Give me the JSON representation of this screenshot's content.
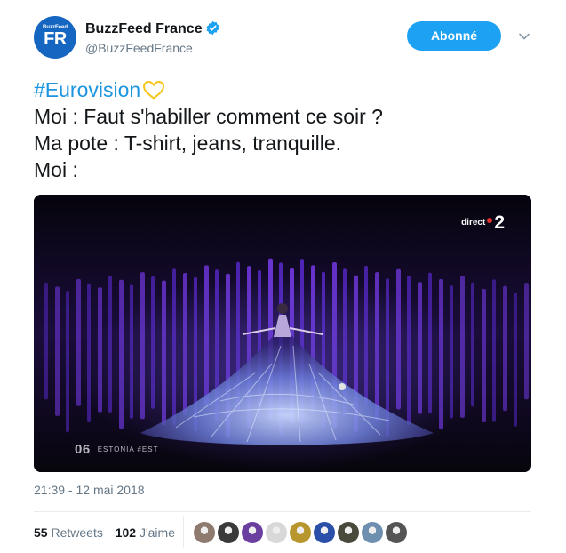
{
  "account": {
    "avatar_small": "BuzzFeed",
    "avatar_big": "FR",
    "name": "BuzzFeed France",
    "handle": "@BuzzFeedFrance",
    "verified_icon": "verified-badge-icon",
    "follow_label": "Abonné",
    "menu_icon": "chevron-down-icon"
  },
  "tweet": {
    "hashtag": "#Eurovision",
    "hashtag_emoji": "yellow-heart-icon",
    "line1": "Moi : Faut s'habiller comment ce soir ?",
    "line2": "Ma pote : T-shirt, jeans, tranquille.",
    "line3": "Moi :"
  },
  "media": {
    "channel_label": "direct",
    "channel_number": "2",
    "performer_number": "06",
    "performer_country": "ESTONIA #EST"
  },
  "meta": {
    "timestamp": "21:39 - 12 mai 2018",
    "retweets_count": "55",
    "retweets_label": "Retweets",
    "likes_count": "102",
    "likes_label": "J'aime"
  },
  "colors": {
    "accent": "#1da1f2",
    "hashtag": "#1b95e0",
    "avatar_bg": "#1566c0",
    "secondary_text": "#657786"
  },
  "likers": [
    {
      "name": "liker-avatar-1",
      "color": "#8f7a6e"
    },
    {
      "name": "liker-avatar-2",
      "color": "#3a3a3a"
    },
    {
      "name": "liker-avatar-3",
      "color": "#6b3fa0"
    },
    {
      "name": "liker-avatar-4",
      "color": "#d8d8d8"
    },
    {
      "name": "liker-avatar-5",
      "color": "#b8962e"
    },
    {
      "name": "liker-avatar-6",
      "color": "#2a4fa8"
    },
    {
      "name": "liker-avatar-7",
      "color": "#4a4a3c"
    },
    {
      "name": "liker-avatar-8",
      "color": "#6f8fb0"
    },
    {
      "name": "liker-avatar-9",
      "color": "#555555"
    }
  ]
}
